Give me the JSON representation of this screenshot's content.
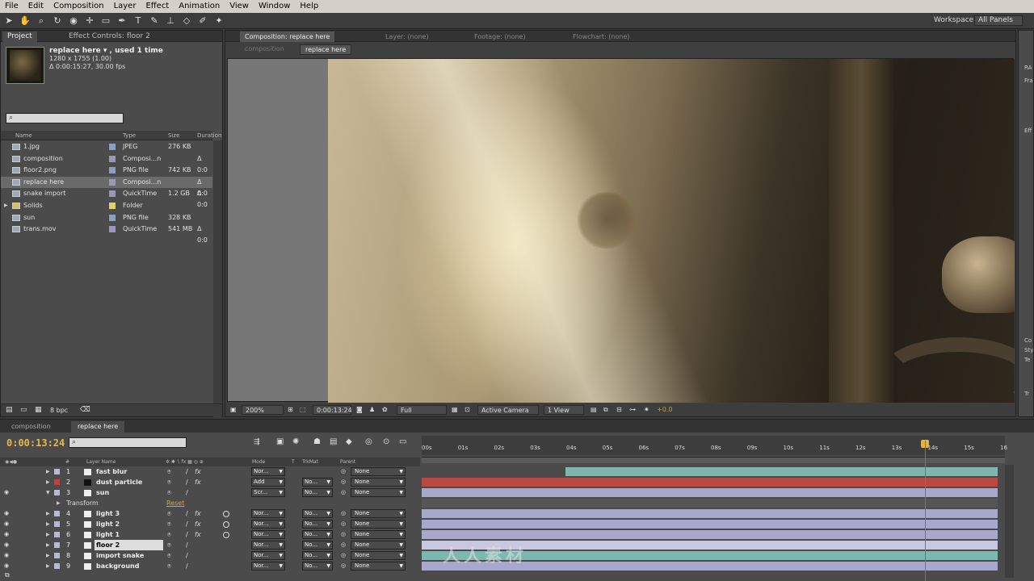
{
  "menubar": [
    "File",
    "Edit",
    "Composition",
    "Layer",
    "Effect",
    "Animation",
    "View",
    "Window",
    "Help"
  ],
  "workspace": {
    "label": "Workspace:",
    "value": "All Panels"
  },
  "project": {
    "tabs": [
      "Project",
      "Effect Controls: floor 2"
    ],
    "selected_name": "replace here ▾ , used 1 time",
    "dims": "1280 x 1755 (1.00)",
    "duration": "Δ 0:00:15:27, 30.00 fps",
    "columns": [
      "Name",
      "Type",
      "Size",
      "Duration"
    ],
    "items": [
      {
        "name": "1.jpg",
        "type": "JPEG",
        "size": "276 KB",
        "dur": "",
        "swatch": "#8aa0c0"
      },
      {
        "name": "composition",
        "type": "Composi...n",
        "size": "",
        "dur": "Δ 0:0",
        "swatch": "#9a9ab8"
      },
      {
        "name": "floor2.png",
        "type": "PNG file",
        "size": "742 KB",
        "dur": "",
        "swatch": "#8aa0c0"
      },
      {
        "name": "replace here",
        "type": "Composi...n",
        "size": "",
        "dur": "Δ 0:0",
        "swatch": "#9a9ab8"
      },
      {
        "name": "snake import",
        "type": "QuickTime",
        "size": "1.2 GB",
        "dur": "Δ 0:0",
        "swatch": "#9a9ab8"
      },
      {
        "name": "Solids",
        "type": "Folder",
        "size": "",
        "dur": "",
        "swatch": "#e0d070"
      },
      {
        "name": "sun",
        "type": "PNG file",
        "size": "328 KB",
        "dur": "",
        "swatch": "#8aa0c0"
      },
      {
        "name": "trans.mov",
        "type": "QuickTime",
        "size": "541 MB",
        "dur": "Δ 0:0",
        "swatch": "#9a9ab8"
      }
    ],
    "bpc": "8 bpc"
  },
  "composition": {
    "tabs": [
      "Composition: replace here",
      "Layer: (none)",
      "Footage: (none)",
      "Flowchart: (none)"
    ],
    "crumbs": [
      "composition",
      "replace here"
    ],
    "footer": {
      "zoom": "200%",
      "timecode": "0:00:13:24",
      "resolution": "Full",
      "camera": "Active Camera",
      "views": "1 View",
      "exposure": "+0.0"
    }
  },
  "right_panel": [
    "RA",
    "Fra",
    "Eff",
    "Co",
    "Sty",
    "Te",
    "Tr"
  ],
  "timeline": {
    "tabs": [
      "composition",
      "replace here"
    ],
    "timecode": "0:00:13:24",
    "columns": [
      "#",
      "Layer Name",
      "Mode",
      "T",
      "TrkMat",
      "Parent"
    ],
    "ticks": [
      "00s",
      "01s",
      "02s",
      "03s",
      "04s",
      "05s",
      "06s",
      "07s",
      "08s",
      "09s",
      "10s",
      "11s",
      "12s",
      "13s",
      "14s",
      "15s",
      "16"
    ],
    "transform_label": "Transform",
    "reset_label": "Reset",
    "layers": [
      {
        "num": "1",
        "name": "fast blur",
        "mode": "Nor...",
        "trk": "",
        "parent": "None",
        "color": "#b8b8d8",
        "fx": true,
        "dot": false,
        "bar": "#7ab8b0",
        "bar_start": 0.25,
        "selected": false
      },
      {
        "num": "2",
        "name": "dust particle",
        "mode": "Add",
        "trk": "No...",
        "parent": "None",
        "color": "#cc3a3a",
        "fx": true,
        "dot": false,
        "bar": "#b84a44",
        "bar_start": 0,
        "selected": false
      },
      {
        "num": "3",
        "name": "sun",
        "mode": "Scr...",
        "trk": "No...",
        "parent": "None",
        "color": "#b8b8d8",
        "fx": false,
        "dot": false,
        "bar": "#a8a8cc",
        "bar_start": 0,
        "selected": false
      },
      {
        "num": "4",
        "name": "light 3",
        "mode": "Nor...",
        "trk": "No...",
        "parent": "None",
        "color": "#b8b8d8",
        "fx": true,
        "dot": true,
        "bar": "#a8a8cc",
        "bar_start": 0,
        "selected": false
      },
      {
        "num": "5",
        "name": "light 2",
        "mode": "Nor...",
        "trk": "No...",
        "parent": "None",
        "color": "#b8b8d8",
        "fx": true,
        "dot": true,
        "bar": "#a8a8cc",
        "bar_start": 0,
        "selected": false
      },
      {
        "num": "6",
        "name": "light 1",
        "mode": "Nor...",
        "trk": "No...",
        "parent": "None",
        "color": "#b8b8d8",
        "fx": true,
        "dot": true,
        "bar": "#a8a8cc",
        "bar_start": 0,
        "selected": false
      },
      {
        "num": "7",
        "name": "floor 2",
        "mode": "Nor...",
        "trk": "No...",
        "parent": "None",
        "color": "#b8b8d8",
        "fx": false,
        "dot": false,
        "bar": "#c8c8e0",
        "bar_start": 0,
        "selected": true
      },
      {
        "num": "8",
        "name": "import snake",
        "mode": "Nor...",
        "trk": "No...",
        "parent": "None",
        "color": "#b8b8d8",
        "fx": false,
        "dot": false,
        "bar": "#7ab8b0",
        "bar_start": 0,
        "selected": false
      },
      {
        "num": "9",
        "name": "background",
        "mode": "Nor...",
        "trk": "No...",
        "parent": "None",
        "color": "#b8b8d8",
        "fx": false,
        "dot": false,
        "bar": "#a8a8cc",
        "bar_start": 0,
        "selected": false
      }
    ],
    "current_time_fraction": 0.863
  },
  "watermark": "人人素材",
  "colors": {
    "timecode": "#e6b84c",
    "cti": "#e04a3a",
    "reset": "#d8a640"
  }
}
